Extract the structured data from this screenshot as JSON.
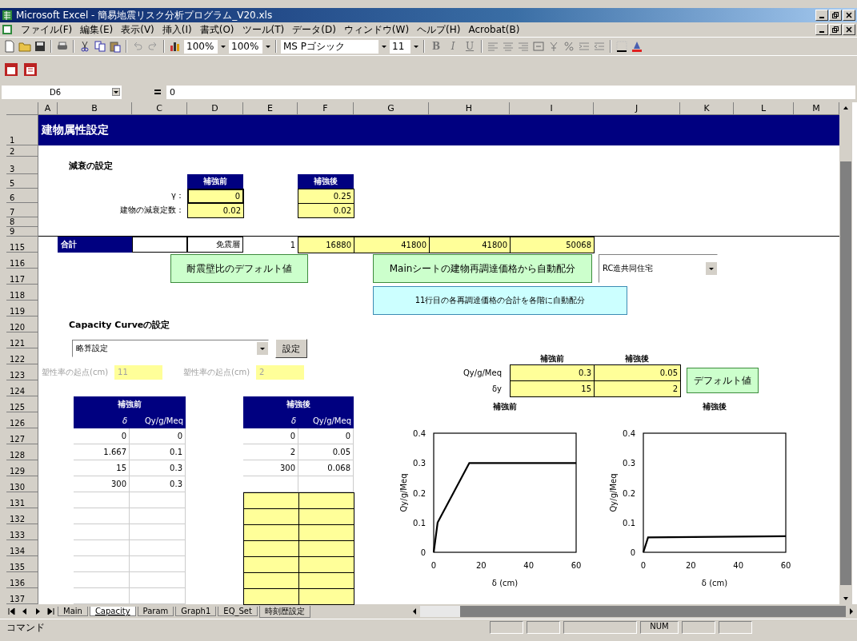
{
  "window": {
    "title": "Microsoft Excel - 簡易地震リスク分析プログラム_V20.xls"
  },
  "menu": [
    "ファイル(F)",
    "編集(E)",
    "表示(V)",
    "挿入(I)",
    "書式(O)",
    "ツール(T)",
    "データ(D)",
    "ウィンドウ(W)",
    "ヘルプ(H)",
    "Acrobat(B)"
  ],
  "toolbar": {
    "zoom_1": "100%",
    "zoom_2": "100%",
    "font": "MS Pゴシック",
    "font_size": "11",
    "format_buttons": [
      "B",
      "I",
      "U"
    ]
  },
  "formula_bar": {
    "name_box": "D6",
    "value": "0"
  },
  "columns": [
    "A",
    "B",
    "C",
    "D",
    "E",
    "F",
    "G",
    "H",
    "I",
    "J",
    "K",
    "L",
    "M"
  ],
  "rows": [
    "1",
    "2",
    "3",
    "5",
    "6",
    "7",
    "8",
    "9",
    "115",
    "116",
    "117",
    "118",
    "119",
    "120",
    "121",
    "122",
    "123",
    "124",
    "125",
    "126",
    "127",
    "128",
    "129",
    "130",
    "131",
    "132",
    "133",
    "134",
    "135",
    "136",
    "137"
  ],
  "sheet": {
    "title": "建物属性設定",
    "damping": {
      "heading": "減衰の設定",
      "headers": [
        "補強前",
        "補強後"
      ],
      "rows": [
        {
          "label": "γ：",
          "values": [
            "0",
            "0.25"
          ]
        },
        {
          "label": "建物の減衰定数：",
          "values": [
            "0.02",
            "0.02"
          ]
        }
      ]
    },
    "total_row": {
      "label": "合計",
      "floor": "免震層",
      "count": "1",
      "values": [
        "16880",
        "41800",
        "41800",
        "50068"
      ]
    },
    "wall_button": "耐震壁比のデフォルト値",
    "main_button": "Mainシートの建物再調達価格から自動配分",
    "use_combo": "RC造共同住宅",
    "sum_button": "11行目の各再調達価格の合計を各階に自動配分",
    "capacity": {
      "heading": "Capacity Curveの設定",
      "combo": "略算設定",
      "set_button": "設定",
      "ductility": [
        {
          "label": "塑性率の起点(cm)",
          "value": "11",
          "disabled": true
        },
        {
          "label": "塑性率の起点(cm)",
          "value": "2",
          "disabled": true
        }
      ],
      "params": {
        "headers": [
          "補強前",
          "補強後"
        ],
        "rows": [
          {
            "label": "Qy/g/Meq",
            "values": [
              "0.3",
              "0.05"
            ]
          },
          {
            "label": "δy",
            "values": [
              "15",
              "2"
            ]
          }
        ],
        "button": "デフォルト値"
      }
    },
    "tables": [
      {
        "title": "補強前",
        "columns": [
          "δ",
          "Qy/g/Meq"
        ],
        "rows": [
          {
            "kind": "value",
            "cells": [
              "0",
              "0"
            ]
          },
          {
            "kind": "value",
            "cells": [
              "1.667",
              "0.1"
            ]
          },
          {
            "kind": "value",
            "cells": [
              "15",
              "0.3"
            ]
          },
          {
            "kind": "value",
            "cells": [
              "300",
              "0.3"
            ]
          },
          {
            "kind": "blank"
          },
          {
            "kind": "blank"
          },
          {
            "kind": "blank"
          },
          {
            "kind": "blank"
          },
          {
            "kind": "blank"
          },
          {
            "kind": "blank"
          },
          {
            "kind": "blank"
          }
        ]
      },
      {
        "title": "補強後",
        "columns": [
          "δ",
          "Qy/g/Meq"
        ],
        "rows": [
          {
            "kind": "value",
            "cells": [
              "0",
              "0"
            ]
          },
          {
            "kind": "value",
            "cells": [
              "2",
              "0.05"
            ]
          },
          {
            "kind": "value",
            "cells": [
              "300",
              "0.068"
            ]
          },
          {
            "kind": "blank"
          },
          {
            "kind": "input"
          },
          {
            "kind": "input"
          },
          {
            "kind": "input"
          },
          {
            "kind": "input"
          },
          {
            "kind": "input"
          },
          {
            "kind": "input"
          },
          {
            "kind": "input"
          }
        ]
      }
    ],
    "charts": [
      {
        "chart_data": {
          "type": "line",
          "title": "補強前",
          "xlabel": "δ (cm)",
          "ylabel": "Qy/g/Meq",
          "x": [
            0,
            1.667,
            15,
            60
          ],
          "series": [
            {
              "color": "#000000",
              "values": [
                0,
                0.1,
                0.3,
                0.3
              ]
            }
          ],
          "xlim": [
            0,
            60
          ],
          "ylim": [
            0,
            0.4
          ],
          "xticks": [
            0,
            20,
            40,
            60
          ],
          "yticks": [
            0,
            0.1,
            0.2,
            0.3,
            0.4
          ]
        }
      },
      {
        "chart_data": {
          "type": "line",
          "title": "補強後",
          "xlabel": "δ (cm)",
          "ylabel": "Qy/g/Meq",
          "x": [
            0,
            2,
            60
          ],
          "series": [
            {
              "color": "#000000",
              "values": [
                0,
                0.05,
                0.054
              ]
            }
          ],
          "xlim": [
            0,
            60
          ],
          "ylim": [
            0,
            0.4
          ],
          "xticks": [
            0,
            20,
            40,
            60
          ],
          "yticks": [
            0,
            0.1,
            0.2,
            0.3,
            0.4
          ]
        }
      }
    ]
  },
  "sheet_tabs": [
    {
      "label": "Main",
      "selected": false
    },
    {
      "label": "Capacity",
      "selected": true
    },
    {
      "label": "Param",
      "selected": false
    },
    {
      "label": "Graph1",
      "selected": false
    },
    {
      "label": "EQ_Set",
      "selected": false
    },
    {
      "label": "時刻歴設定",
      "selected": false
    }
  ],
  "status_bar": {
    "mode": "コマンド",
    "indicator": "NUM"
  }
}
